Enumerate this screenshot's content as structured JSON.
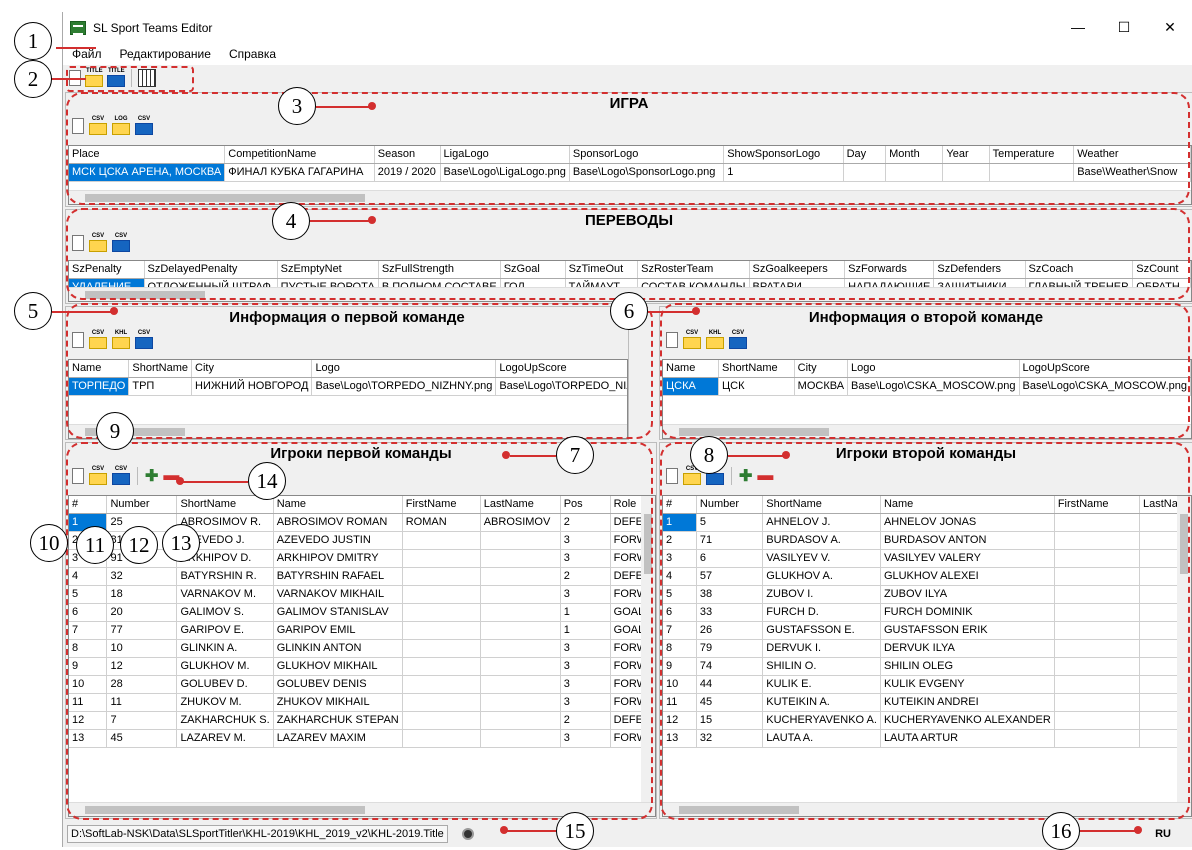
{
  "window": {
    "title": "SL Sport Teams Editor",
    "minimize": "—",
    "maximize": "☐",
    "close": "✕"
  },
  "menu": [
    "Файл",
    "Редактирование",
    "Справка"
  ],
  "sections": {
    "game": "ИГРА",
    "translations": "ПЕРЕВОДЫ",
    "team1_info": "Информация о первой команде",
    "team2_info": "Информация о второй команде",
    "team1_players": "Игроки первой команды",
    "team2_players": "Игроки второй команды"
  },
  "icon_caps": {
    "csv": "CSV",
    "log": "LOG",
    "khl": "KHL",
    "title": "TITLE"
  },
  "game_grid": {
    "headers": [
      "Place",
      "CompetitionName",
      "Season",
      "LigaLogo",
      "SponsorLogo",
      "ShowSponsorLogo",
      "Day",
      "Month",
      "Year",
      "Temperature",
      "Weather"
    ],
    "row": [
      "МСК ЦСКА АРЕНА, МОСКВА",
      "ФИНАЛ КУБКА ГАГАРИНА",
      "2019 / 2020",
      "Base\\Logo\\LigaLogo.png",
      "Base\\Logo\\SponsorLogo.png",
      "1",
      "",
      "",
      "",
      "",
      "Base\\Weather\\Snow"
    ]
  },
  "trans_grid": {
    "headers": [
      "SzPenalty",
      "SzDelayedPenalty",
      "SzEmptyNet",
      "SzFullStrength",
      "SzGoal",
      "SzTimeOut",
      "SzRosterTeam",
      "SzGoalkeepers",
      "SzForwards",
      "SzDefenders",
      "SzCoach",
      "SzCount"
    ],
    "row": [
      "УДАЛЕНИЕ",
      "ОТЛОЖЕННЫЙ ШТРАФ",
      "ПУСТЫЕ ВОРОТА",
      "В ПОЛНОМ СОСТАВЕ",
      "ГОЛ",
      "ТАЙМАУТ",
      "СОСТАВ КОМАНДЫ",
      "ВРАТАРИ",
      "НАПАДАЮЩИЕ",
      "ЗАЩИТНИКИ",
      "ГЛАВНЫЙ ТРЕНЕР",
      "ОБРАТН"
    ]
  },
  "team1_grid": {
    "headers": [
      "Name",
      "ShortName",
      "City",
      "Logo",
      "LogoUpScore"
    ],
    "row": [
      "ТОРПЕДО",
      "ТРП",
      "НИЖНИЙ НОВГОРОД",
      "Base\\Logo\\TORPEDO_NIZHNY.png",
      "Base\\Logo\\TORPEDO_NIZ"
    ]
  },
  "team2_grid": {
    "headers": [
      "Name",
      "ShortName",
      "City",
      "Logo",
      "LogoUpScore"
    ],
    "row": [
      "ЦСКА",
      "ЦСК",
      "МОСКВА",
      "Base\\Logo\\CSKA_MOSCOW.png",
      "Base\\Logo\\CSKA_MOSCOW.png"
    ]
  },
  "players1": {
    "headers": [
      "#",
      "Number",
      "ShortName",
      "Name",
      "FirstName",
      "LastName",
      "Pos",
      "Role"
    ],
    "rows": [
      [
        "1",
        "25",
        "ABROSIMOV R.",
        "ABROSIMOV ROMAN",
        "ROMAN",
        "ABROSIMOV",
        "2",
        "DEFEN"
      ],
      [
        "2",
        "81",
        "AZEVEDO J.",
        "AZEVEDO JUSTIN",
        "",
        "",
        "3",
        "FORW"
      ],
      [
        "3",
        "91",
        "ARKHIPOV D.",
        "ARKHIPOV DMITRY",
        "",
        "",
        "3",
        "FORW"
      ],
      [
        "4",
        "32",
        "BATYRSHIN R.",
        "BATYRSHIN RAFAEL",
        "",
        "",
        "2",
        "DEFEN"
      ],
      [
        "5",
        "18",
        "VARNAKOV M.",
        "VARNAKOV MIKHAIL",
        "",
        "",
        "3",
        "FORW"
      ],
      [
        "6",
        "20",
        "GALIMOV S.",
        "GALIMOV STANISLAV",
        "",
        "",
        "1",
        "GOALT"
      ],
      [
        "7",
        "77",
        "GARIPOV E.",
        "GARIPOV EMIL",
        "",
        "",
        "1",
        "GOALT"
      ],
      [
        "8",
        "10",
        "GLINKIN A.",
        "GLINKIN ANTON",
        "",
        "",
        "3",
        "FORW"
      ],
      [
        "9",
        "12",
        "GLUKHOV M.",
        "GLUKHOV MIKHAIL",
        "",
        "",
        "3",
        "FORW"
      ],
      [
        "10",
        "28",
        "GOLUBEV D.",
        "GOLUBEV DENIS",
        "",
        "",
        "3",
        "FORW"
      ],
      [
        "11",
        "11",
        "ZHUKOV M.",
        "ZHUKOV MIKHAIL",
        "",
        "",
        "3",
        "FORW"
      ],
      [
        "12",
        "7",
        "ZAKHARCHUK S.",
        "ZAKHARCHUK STEPAN",
        "",
        "",
        "2",
        "DEFEN"
      ],
      [
        "13",
        "45",
        "LAZAREV M.",
        "LAZAREV MAXIM",
        "",
        "",
        "3",
        "FORW"
      ]
    ]
  },
  "players2": {
    "headers": [
      "#",
      "Number",
      "ShortName",
      "Name",
      "FirstName",
      "LastNam"
    ],
    "rows": [
      [
        "1",
        "5",
        "AHNELOV J.",
        "AHNELOV JONAS",
        "",
        ""
      ],
      [
        "2",
        "71",
        "BURDASOV A.",
        "BURDASOV ANTON",
        "",
        ""
      ],
      [
        "3",
        "6",
        "VASILYEV V.",
        "VASILYEV VALERY",
        "",
        ""
      ],
      [
        "4",
        "57",
        "GLUKHOV A.",
        "GLUKHOV ALEXEI",
        "",
        ""
      ],
      [
        "5",
        "38",
        "ZUBOV I.",
        "ZUBOV ILYA",
        "",
        ""
      ],
      [
        "6",
        "33",
        "FURCH D.",
        "FURCH DOMINIK",
        "",
        ""
      ],
      [
        "7",
        "26",
        "GUSTAFSSON E.",
        "GUSTAFSSON ERIK",
        "",
        ""
      ],
      [
        "8",
        "79",
        "DERVUK I.",
        "DERVUK ILYA",
        "",
        ""
      ],
      [
        "9",
        "74",
        "SHILIN O.",
        "SHILIN OLEG",
        "",
        ""
      ],
      [
        "10",
        "44",
        "KULIK E.",
        "KULIK EVGENY",
        "",
        ""
      ],
      [
        "11",
        "45",
        "KUTEIKIN A.",
        "KUTEIKIN ANDREI",
        "",
        ""
      ],
      [
        "12",
        "15",
        "KUCHERYAVENKO A.",
        "KUCHERYAVENKO ALEXANDER",
        "",
        ""
      ],
      [
        "13",
        "32",
        "LAUTA A.",
        "LAUTA ARTUR",
        "",
        ""
      ]
    ]
  },
  "status": {
    "path": "D:\\SoftLab-NSK\\Data\\SLSportTitler\\KHL-2019\\KHL_2019_v2\\KHL-2019.Title",
    "lang": "RU"
  },
  "callouts": [
    "1",
    "2",
    "3",
    "4",
    "5",
    "6",
    "7",
    "8",
    "9",
    "10",
    "11",
    "12",
    "13",
    "14",
    "15",
    "16"
  ],
  "accent_color": "#d32f2f",
  "selection_color": "#0078d7"
}
